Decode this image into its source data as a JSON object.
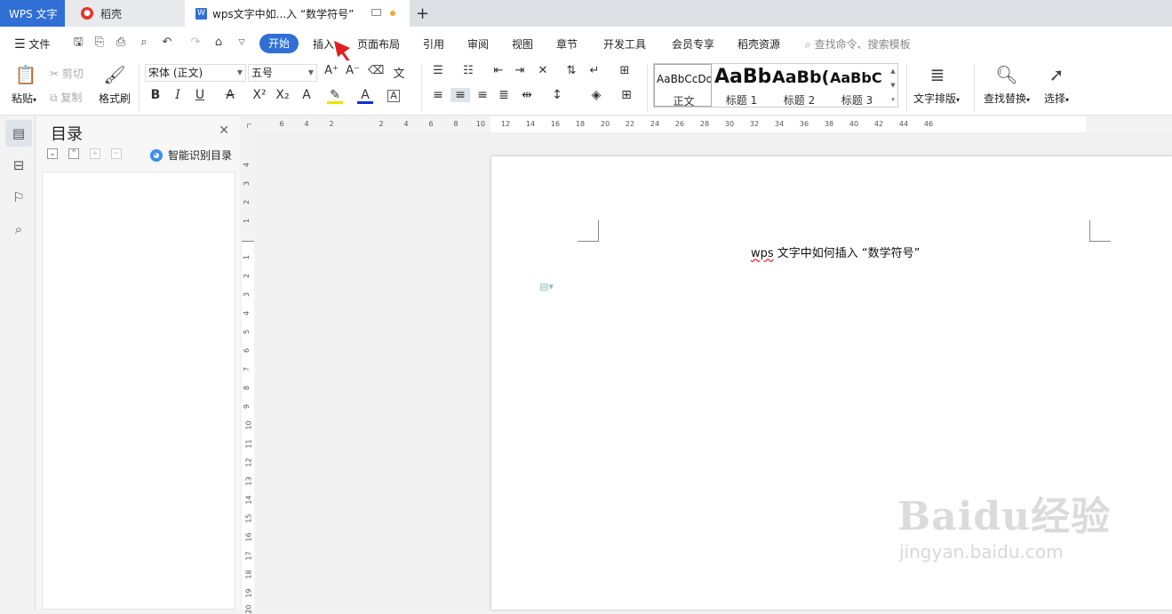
{
  "tabs": {
    "app": "WPS 文字",
    "docer": "稻壳",
    "doc": "wps文字中如...入 “数学符号”",
    "add": "+"
  },
  "menu": {
    "file": "文件",
    "items": [
      "开始",
      "插入",
      "页面布局",
      "引用",
      "审阅",
      "视图",
      "章节",
      "开发工具",
      "会员专享",
      "稻壳资源"
    ],
    "search": "查找命令、搜索模板"
  },
  "ribbon": {
    "paste": "粘贴",
    "cut": "剪切",
    "copy": "复制",
    "format_painter": "格式刷",
    "font_name": "宋体 (正文)",
    "font_size": "五号",
    "styles": [
      {
        "preview": "AaBbCcDd",
        "name": "正文"
      },
      {
        "preview": "AaBb",
        "name": "标题 1"
      },
      {
        "preview": "AaBb(",
        "name": "标题 2"
      },
      {
        "preview": "AaBbC",
        "name": "标题 3"
      }
    ],
    "text_layout": "文字排版",
    "find_replace": "查找替换",
    "select": "选择"
  },
  "toc": {
    "title": "目录",
    "smart": "智能识别目录"
  },
  "document": {
    "text_prefix": "wps",
    "text_rest": " 文字中如何插入 “数学符号”"
  },
  "hruler_ticks": [
    "6",
    "4",
    "2",
    "2",
    "4",
    "6",
    "8",
    "10",
    "12",
    "14",
    "16",
    "18",
    "20",
    "22",
    "24",
    "26",
    "28",
    "30",
    "32",
    "34",
    "36",
    "38",
    "40",
    "42",
    "44",
    "46"
  ],
  "vruler_ticks": [
    "4",
    "3",
    "2",
    "1",
    "1",
    "2",
    "3",
    "4",
    "5",
    "6",
    "7",
    "8",
    "9",
    "10",
    "11",
    "12",
    "13",
    "14",
    "15",
    "16",
    "17",
    "18",
    "19",
    "20"
  ],
  "watermark": {
    "brand": "Baidu经验",
    "url": "jingyan.baidu.com"
  },
  "colors": {
    "accent": "#2f6fd6",
    "highlight": "#f5e000",
    "font_color": "#1030d0",
    "annotation_arrow": "#e02020"
  }
}
